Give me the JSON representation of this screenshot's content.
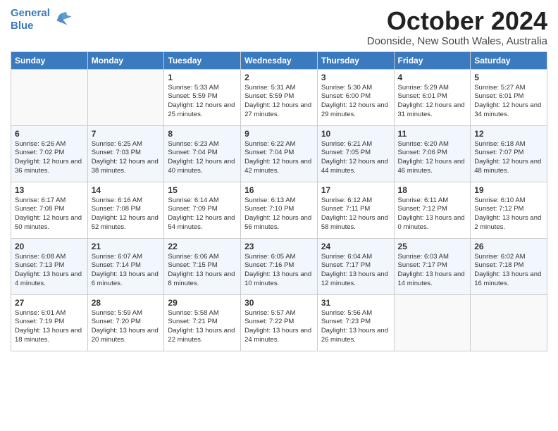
{
  "header": {
    "logo_line1": "General",
    "logo_line2": "Blue",
    "month": "October 2024",
    "location": "Doonside, New South Wales, Australia"
  },
  "days_of_week": [
    "Sunday",
    "Monday",
    "Tuesday",
    "Wednesday",
    "Thursday",
    "Friday",
    "Saturday"
  ],
  "weeks": [
    [
      {
        "day": "",
        "empty": true
      },
      {
        "day": "",
        "empty": true
      },
      {
        "day": "1",
        "sunrise": "Sunrise: 5:33 AM",
        "sunset": "Sunset: 5:59 PM",
        "daylight": "Daylight: 12 hours and 25 minutes."
      },
      {
        "day": "2",
        "sunrise": "Sunrise: 5:31 AM",
        "sunset": "Sunset: 5:59 PM",
        "daylight": "Daylight: 12 hours and 27 minutes."
      },
      {
        "day": "3",
        "sunrise": "Sunrise: 5:30 AM",
        "sunset": "Sunset: 6:00 PM",
        "daylight": "Daylight: 12 hours and 29 minutes."
      },
      {
        "day": "4",
        "sunrise": "Sunrise: 5:29 AM",
        "sunset": "Sunset: 6:01 PM",
        "daylight": "Daylight: 12 hours and 31 minutes."
      },
      {
        "day": "5",
        "sunrise": "Sunrise: 5:27 AM",
        "sunset": "Sunset: 6:01 PM",
        "daylight": "Daylight: 12 hours and 34 minutes."
      }
    ],
    [
      {
        "day": "6",
        "sunrise": "Sunrise: 6:26 AM",
        "sunset": "Sunset: 7:02 PM",
        "daylight": "Daylight: 12 hours and 36 minutes."
      },
      {
        "day": "7",
        "sunrise": "Sunrise: 6:25 AM",
        "sunset": "Sunset: 7:03 PM",
        "daylight": "Daylight: 12 hours and 38 minutes."
      },
      {
        "day": "8",
        "sunrise": "Sunrise: 6:23 AM",
        "sunset": "Sunset: 7:04 PM",
        "daylight": "Daylight: 12 hours and 40 minutes."
      },
      {
        "day": "9",
        "sunrise": "Sunrise: 6:22 AM",
        "sunset": "Sunset: 7:04 PM",
        "daylight": "Daylight: 12 hours and 42 minutes."
      },
      {
        "day": "10",
        "sunrise": "Sunrise: 6:21 AM",
        "sunset": "Sunset: 7:05 PM",
        "daylight": "Daylight: 12 hours and 44 minutes."
      },
      {
        "day": "11",
        "sunrise": "Sunrise: 6:20 AM",
        "sunset": "Sunset: 7:06 PM",
        "daylight": "Daylight: 12 hours and 46 minutes."
      },
      {
        "day": "12",
        "sunrise": "Sunrise: 6:18 AM",
        "sunset": "Sunset: 7:07 PM",
        "daylight": "Daylight: 12 hours and 48 minutes."
      }
    ],
    [
      {
        "day": "13",
        "sunrise": "Sunrise: 6:17 AM",
        "sunset": "Sunset: 7:08 PM",
        "daylight": "Daylight: 12 hours and 50 minutes."
      },
      {
        "day": "14",
        "sunrise": "Sunrise: 6:16 AM",
        "sunset": "Sunset: 7:08 PM",
        "daylight": "Daylight: 12 hours and 52 minutes."
      },
      {
        "day": "15",
        "sunrise": "Sunrise: 6:14 AM",
        "sunset": "Sunset: 7:09 PM",
        "daylight": "Daylight: 12 hours and 54 minutes."
      },
      {
        "day": "16",
        "sunrise": "Sunrise: 6:13 AM",
        "sunset": "Sunset: 7:10 PM",
        "daylight": "Daylight: 12 hours and 56 minutes."
      },
      {
        "day": "17",
        "sunrise": "Sunrise: 6:12 AM",
        "sunset": "Sunset: 7:11 PM",
        "daylight": "Daylight: 12 hours and 58 minutes."
      },
      {
        "day": "18",
        "sunrise": "Sunrise: 6:11 AM",
        "sunset": "Sunset: 7:12 PM",
        "daylight": "Daylight: 13 hours and 0 minutes."
      },
      {
        "day": "19",
        "sunrise": "Sunrise: 6:10 AM",
        "sunset": "Sunset: 7:12 PM",
        "daylight": "Daylight: 13 hours and 2 minutes."
      }
    ],
    [
      {
        "day": "20",
        "sunrise": "Sunrise: 6:08 AM",
        "sunset": "Sunset: 7:13 PM",
        "daylight": "Daylight: 13 hours and 4 minutes."
      },
      {
        "day": "21",
        "sunrise": "Sunrise: 6:07 AM",
        "sunset": "Sunset: 7:14 PM",
        "daylight": "Daylight: 13 hours and 6 minutes."
      },
      {
        "day": "22",
        "sunrise": "Sunrise: 6:06 AM",
        "sunset": "Sunset: 7:15 PM",
        "daylight": "Daylight: 13 hours and 8 minutes."
      },
      {
        "day": "23",
        "sunrise": "Sunrise: 6:05 AM",
        "sunset": "Sunset: 7:16 PM",
        "daylight": "Daylight: 13 hours and 10 minutes."
      },
      {
        "day": "24",
        "sunrise": "Sunrise: 6:04 AM",
        "sunset": "Sunset: 7:17 PM",
        "daylight": "Daylight: 13 hours and 12 minutes."
      },
      {
        "day": "25",
        "sunrise": "Sunrise: 6:03 AM",
        "sunset": "Sunset: 7:17 PM",
        "daylight": "Daylight: 13 hours and 14 minutes."
      },
      {
        "day": "26",
        "sunrise": "Sunrise: 6:02 AM",
        "sunset": "Sunset: 7:18 PM",
        "daylight": "Daylight: 13 hours and 16 minutes."
      }
    ],
    [
      {
        "day": "27",
        "sunrise": "Sunrise: 6:01 AM",
        "sunset": "Sunset: 7:19 PM",
        "daylight": "Daylight: 13 hours and 18 minutes."
      },
      {
        "day": "28",
        "sunrise": "Sunrise: 5:59 AM",
        "sunset": "Sunset: 7:20 PM",
        "daylight": "Daylight: 13 hours and 20 minutes."
      },
      {
        "day": "29",
        "sunrise": "Sunrise: 5:58 AM",
        "sunset": "Sunset: 7:21 PM",
        "daylight": "Daylight: 13 hours and 22 minutes."
      },
      {
        "day": "30",
        "sunrise": "Sunrise: 5:57 AM",
        "sunset": "Sunset: 7:22 PM",
        "daylight": "Daylight: 13 hours and 24 minutes."
      },
      {
        "day": "31",
        "sunrise": "Sunrise: 5:56 AM",
        "sunset": "Sunset: 7:23 PM",
        "daylight": "Daylight: 13 hours and 26 minutes."
      },
      {
        "day": "",
        "empty": true
      },
      {
        "day": "",
        "empty": true
      }
    ]
  ]
}
